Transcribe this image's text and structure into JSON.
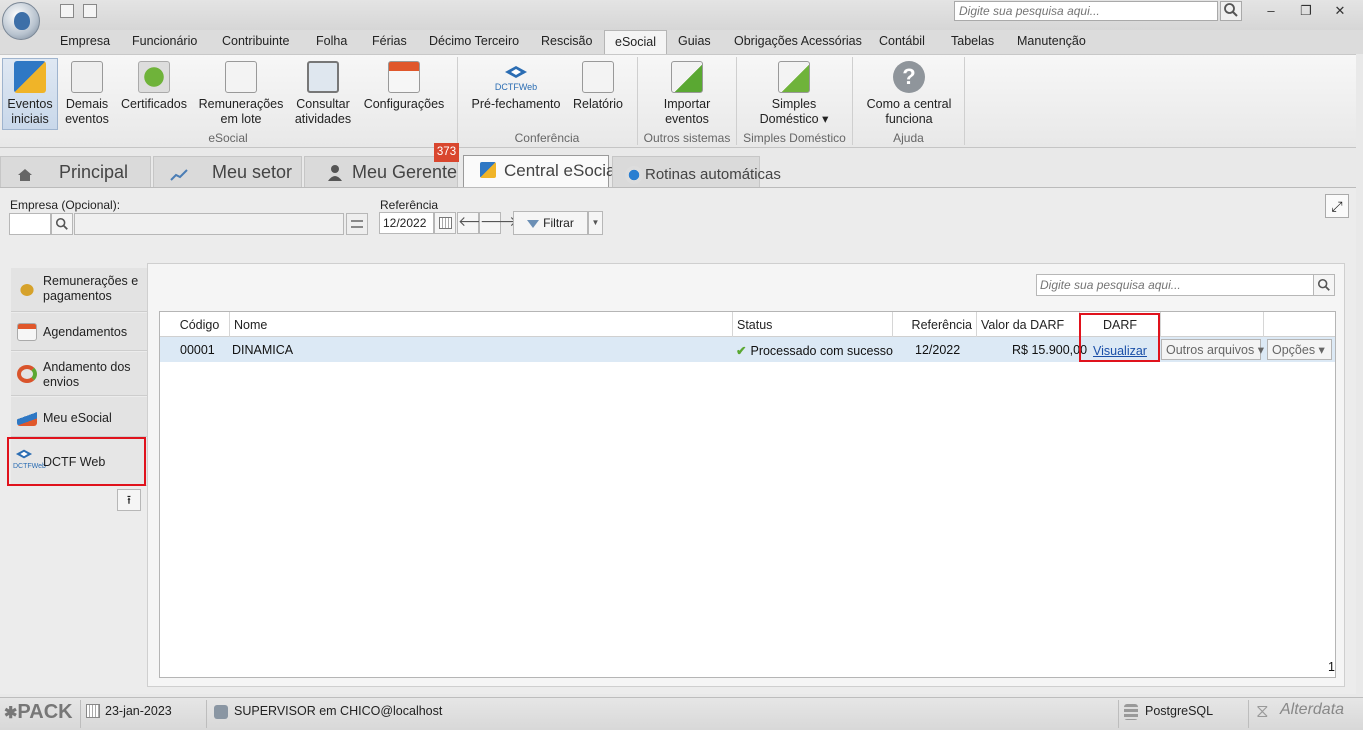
{
  "search": {
    "placeholder": "Digite sua pesquisa aqui..."
  },
  "menu_tabs": [
    "Empresa",
    "Funcionário",
    "Contribuinte",
    "Folha",
    "Férias",
    "Décimo Terceiro",
    "Rescisão",
    "eSocial",
    "Guias",
    "Obrigações Acessórias",
    "Contábil",
    "Tabelas",
    "Manutenção"
  ],
  "ribbon": {
    "buttons": [
      {
        "label1": "Eventos",
        "label2": "iniciais"
      },
      {
        "label1": "Demais",
        "label2": "eventos"
      },
      {
        "label1": "Certificados",
        "label2": ""
      },
      {
        "label1": "Remunerações",
        "label2": "em lote"
      },
      {
        "label1": "Consultar",
        "label2": "atividades"
      },
      {
        "label1": "Configurações",
        "label2": ""
      },
      {
        "label1": "Pré-fechamento",
        "label2": ""
      },
      {
        "label1": "Relatório",
        "label2": ""
      },
      {
        "label1": "Importar",
        "label2": "eventos"
      },
      {
        "label1": "Simples",
        "label2": "Doméstico ▾"
      },
      {
        "label1": "Como a central",
        "label2": "funciona"
      }
    ],
    "groups": [
      "eSocial",
      "Conferência",
      "Outros sistemas",
      "Simples Doméstico",
      "Ajuda"
    ],
    "dctf_text": "DCTFWeb"
  },
  "page_tabs": [
    {
      "label": "Principal"
    },
    {
      "label": "Meu setor"
    },
    {
      "label": "Meu Gerente"
    },
    {
      "label": "Central eSocial"
    },
    {
      "label": "Rotinas automáticas"
    }
  ],
  "badge": "373",
  "filter": {
    "empresa_label": "Empresa (Opcional):",
    "referencia_label": "Referência",
    "referencia_value": "12/2022",
    "filtrar_label": "Filtrar"
  },
  "sidenav": [
    {
      "line1": "Remunerações e",
      "line2": "pagamentos"
    },
    {
      "line1": "Agendamentos",
      "line2": ""
    },
    {
      "line1": "Andamento dos",
      "line2": "envios"
    },
    {
      "line1": "Meu eSocial",
      "line2": ""
    },
    {
      "line1": "DCTF Web",
      "line2": ""
    }
  ],
  "grid": {
    "search_placeholder": "Digite sua pesquisa aqui...",
    "headers": [
      "Código",
      "Nome",
      "Status",
      "Referência",
      "Valor da DARF",
      "DARF"
    ],
    "row": {
      "codigo": "00001",
      "nome": "DINAMICA",
      "status": "Processado com sucesso",
      "referencia": "12/2022",
      "valor": "R$ 15.900,00",
      "darf_link": "Visualizar",
      "outros": "Outros arquivos ▾",
      "opcoes": "Opções ▾"
    },
    "count": "1"
  },
  "statusbar": {
    "pack": "PACK",
    "date": "23-jan-2023",
    "user": "SUPERVISOR em CHICO@localhost",
    "db": "PostgreSQL",
    "brand": "Alterdata"
  },
  "colors": {
    "accent": "#3d6fa8",
    "highlight": "#e0121c",
    "badge": "#d9462e",
    "row_selected": "#dce9f5"
  }
}
